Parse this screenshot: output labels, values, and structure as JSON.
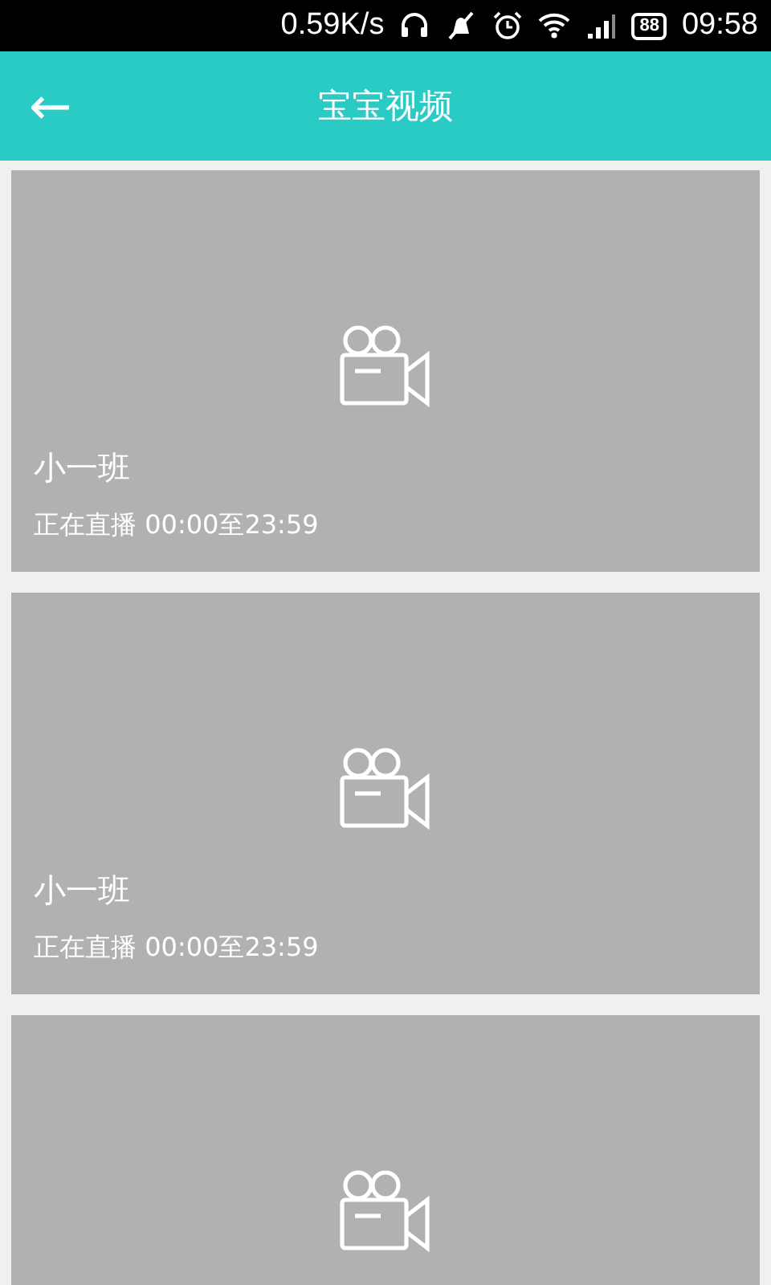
{
  "status_bar": {
    "speed": "0.59K/s",
    "battery": "88",
    "time": "09:58"
  },
  "header": {
    "back": "←",
    "title": "宝宝视频"
  },
  "videos": [
    {
      "kind": "video",
      "name": "小一班",
      "schedule": "正在直播 00:00至23:59"
    },
    {
      "kind": "video",
      "name": "小一班",
      "schedule": "正在直播 00:00至23:59"
    },
    {
      "kind": "video"
    }
  ]
}
